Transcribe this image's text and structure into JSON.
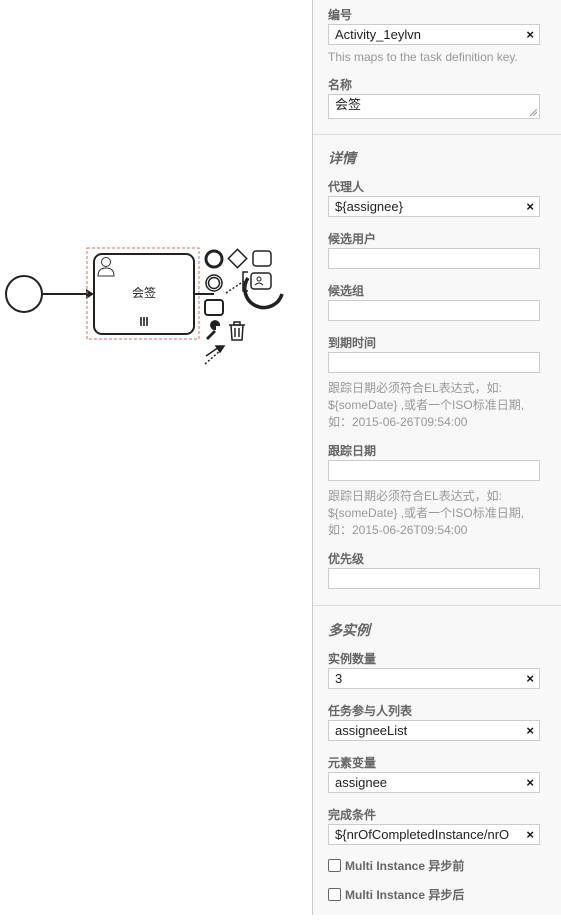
{
  "diagram": {
    "task_label": "会签"
  },
  "panel": {
    "id_label": "编号",
    "id_value": "Activity_1eylvn",
    "id_desc": "This maps to the task definition key.",
    "name_label": "名称",
    "name_value": "会签",
    "details_title": "详情",
    "assignee_label": "代理人",
    "assignee_value": "${assignee}",
    "candidate_users_label": "候选用户",
    "candidate_groups_label": "候选组",
    "due_date_label": "到期时间",
    "due_date_desc_1": "跟踪日期必须符合EL表达式，如:",
    "due_date_desc_2": "${someDate} ,或者一个ISO标准日期,",
    "due_date_desc_3": "如：2015-06-26T09:54:00",
    "follow_up_label": "跟踪日期",
    "follow_up_desc_1": "跟踪日期必须符合EL表达式，如:",
    "follow_up_desc_2": "${someDate} ,或者一个ISO标准日期,",
    "follow_up_desc_3": "如：2015-06-26T09:54:00",
    "priority_label": "优先级",
    "multi_title": "多实例",
    "instances_label": "实例数量",
    "instances_value": "3",
    "collection_label": "任务参与人列表",
    "collection_value": "assigneeList",
    "element_var_label": "元素变量",
    "element_var_value": "assignee",
    "completion_label": "完成条件",
    "completion_value": "${nrOfCompletedInstance/nrO",
    "async_before_label": "Multi Instance 异步前",
    "async_after_label": "Multi Instance 异步后",
    "clear_glyph": "×"
  }
}
